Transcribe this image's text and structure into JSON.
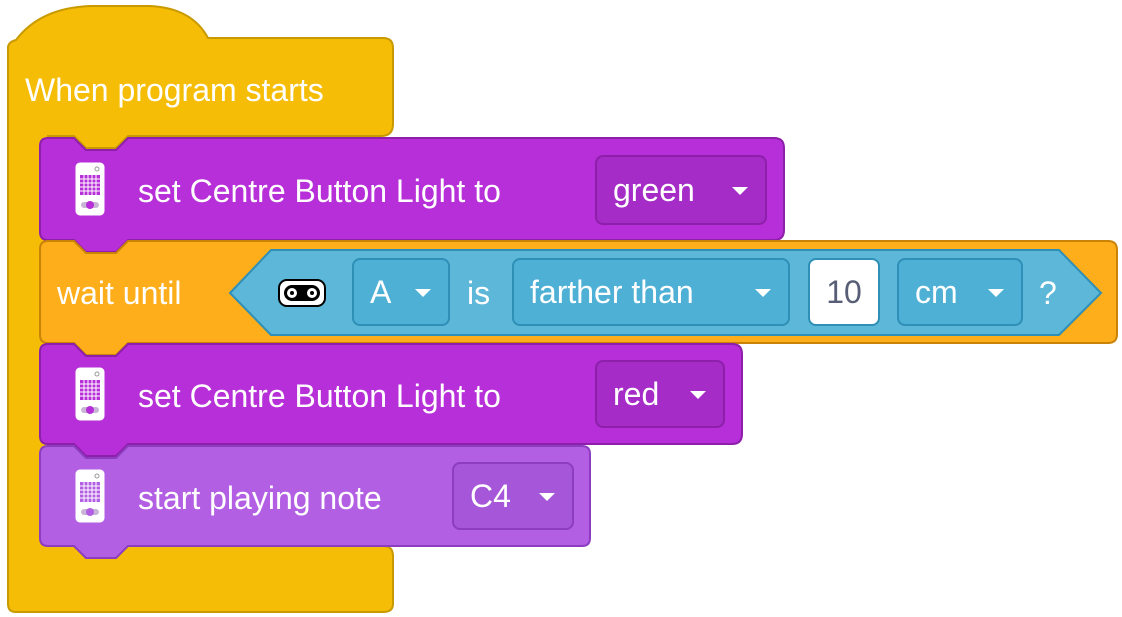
{
  "colors": {
    "events": "#f5bd05",
    "events_border": "#c99a00",
    "light": "#b72fd8",
    "light_border": "#8e1fab",
    "control": "#fdae1a",
    "sensor": "#5cb7d9",
    "sound": "#b35fe3"
  },
  "hat": {
    "label": "When program starts"
  },
  "blocks": [
    {
      "icon": "hub-light-icon",
      "label": "set Centre Button Light to",
      "dropdown": "green"
    },
    {
      "label": "wait until",
      "condition": {
        "sensor_icon": "distance-sensor-icon",
        "port": "A",
        "is_label": "is",
        "comparison": "farther than",
        "value": "10",
        "unit": "cm",
        "question": "?"
      }
    },
    {
      "icon": "hub-light-icon",
      "label": "set Centre Button Light to",
      "dropdown": "red"
    },
    {
      "icon": "hub-sound-icon",
      "label": "start playing note",
      "dropdown": "C4"
    }
  ]
}
